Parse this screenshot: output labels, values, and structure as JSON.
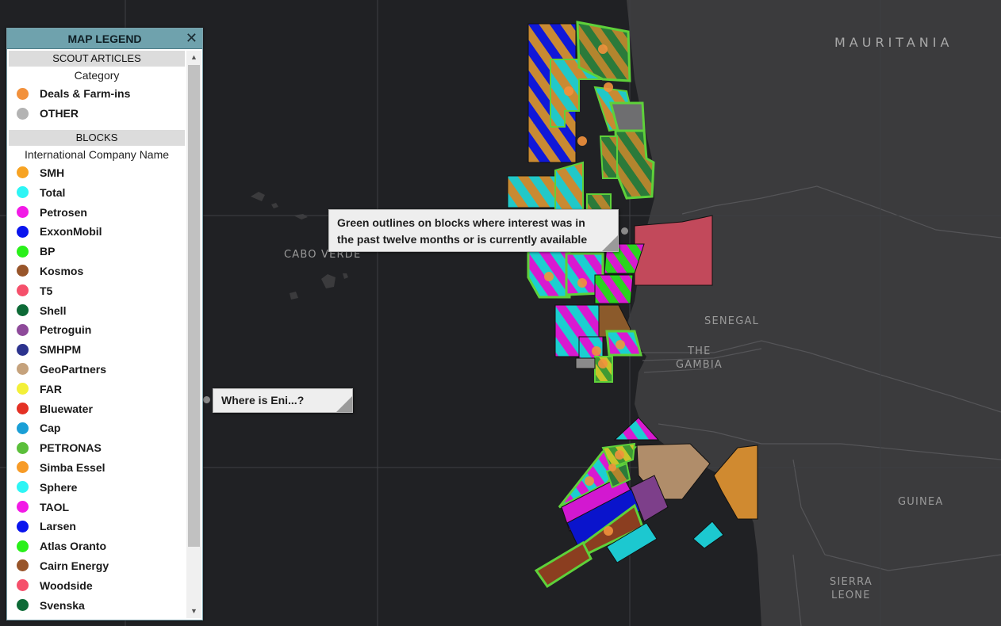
{
  "map": {
    "labels": {
      "mauritania": "MAURITANIA",
      "cabo_verde": "CABO VERDE",
      "senegal": "SENEGAL",
      "the": "THE",
      "gambia": "GAMBIA",
      "guinea": "GUINEA",
      "sierra": "SIERRA",
      "leone": "LEONE"
    },
    "colors": {
      "ocean": "#202124",
      "land": "#3b3b3d",
      "graticule": "#3e3f43",
      "outline_green": "#5ed13a"
    }
  },
  "legend": {
    "title": "MAP LEGEND",
    "close_icon": "✕",
    "sections": {
      "scout": {
        "title": "SCOUT ARTICLES",
        "subtitle": "Category",
        "items": [
          {
            "label": "Deals & Farm-ins",
            "color": "#f2913c"
          },
          {
            "label": "OTHER",
            "color": "#b3b3b3"
          }
        ]
      },
      "blocks": {
        "title": "BLOCKS",
        "subtitle": "International Company Name",
        "items": [
          {
            "label": "SMH",
            "color": "#f7a323"
          },
          {
            "label": "Total",
            "color": "#2ef5f5"
          },
          {
            "label": "Petrosen",
            "color": "#f21ae6"
          },
          {
            "label": "ExxonMobil",
            "color": "#0a14ee"
          },
          {
            "label": "BP",
            "color": "#29f01a"
          },
          {
            "label": "Kosmos",
            "color": "#98552a"
          },
          {
            "label": "T5",
            "color": "#f5506b"
          },
          {
            "label": "Shell",
            "color": "#0d6a36"
          },
          {
            "label": "Petroguin",
            "color": "#8e4a9a"
          },
          {
            "label": "SMHPM",
            "color": "#2c338e"
          },
          {
            "label": "GeoPartners",
            "color": "#c5a27c"
          },
          {
            "label": "FAR",
            "color": "#f3f038"
          },
          {
            "label": "Bluewater",
            "color": "#e43125"
          },
          {
            "label": "Cap",
            "color": "#1a9fd6"
          },
          {
            "label": "PETRONAS",
            "color": "#5bbf3a"
          },
          {
            "label": "Simba Essel",
            "color": "#f79b27"
          },
          {
            "label": "Sphere",
            "color": "#2ef5f5"
          },
          {
            "label": "TAOL",
            "color": "#f21ae6"
          },
          {
            "label": "Larsen",
            "color": "#0a14ee"
          },
          {
            "label": "Atlas Oranto",
            "color": "#29f01a"
          },
          {
            "label": "Cairn Energy",
            "color": "#98552a"
          },
          {
            "label": "Woodside",
            "color": "#f5506b"
          },
          {
            "label": "Svenska",
            "color": "#0d6a36"
          }
        ]
      }
    }
  },
  "callouts": {
    "green_outlines": {
      "line1": "Green outlines on blocks where interest was in",
      "line2": "the past twelve months or is currently available"
    },
    "eni": {
      "text": "Where is Eni...?"
    }
  }
}
